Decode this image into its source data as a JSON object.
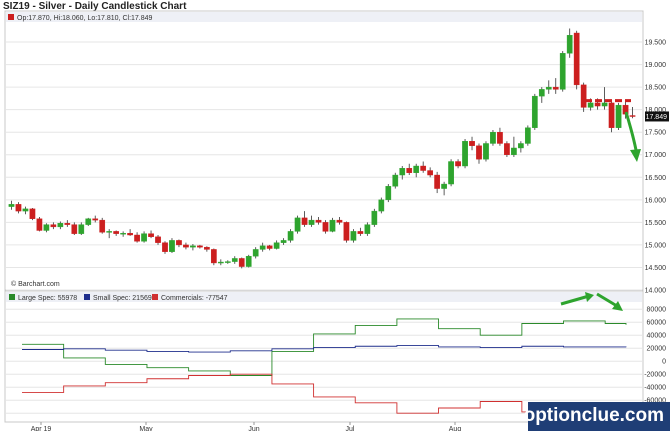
{
  "header": {
    "title": "SIZ19 - Silver - Daily Candlestick Chart",
    "ohlc_label": "Op:17.870, Hi:18.060, Lo:17.810, Cl:17.849",
    "last_price": "17.849",
    "credit": "© Barchart.com"
  },
  "watermark": "optionclue.com",
  "colors": {
    "up": "#2ea42e",
    "down": "#cc1f1f",
    "large_spec": "#2a8a2a",
    "small_spec": "#1f2e8c",
    "commercials": "#d03030",
    "annot_line": "#cc1f1f",
    "annot_arrow": "#2ea42e"
  },
  "chart_data": [
    {
      "type": "candlestick",
      "title": "SIZ19 - Silver - Daily Candlestick Chart",
      "ylim": [
        14.0,
        19.9
      ],
      "y_ticks": [
        "19.500",
        "19.000",
        "18.500",
        "18.000",
        "17.500",
        "17.000",
        "16.500",
        "16.000",
        "15.500",
        "15.000",
        "14.500",
        "14.000"
      ],
      "x_ticks": [
        "Apr 19",
        "May",
        "Jun",
        "Jul",
        "Aug"
      ],
      "annotation": {
        "resistance_level": 18.2,
        "arrow": "down"
      },
      "candles": [
        {
          "o": 15.85,
          "h": 15.98,
          "l": 15.78,
          "c": 15.9
        },
        {
          "o": 15.9,
          "h": 15.95,
          "l": 15.7,
          "c": 15.75
        },
        {
          "o": 15.75,
          "h": 15.85,
          "l": 15.68,
          "c": 15.8
        },
        {
          "o": 15.8,
          "h": 15.82,
          "l": 15.55,
          "c": 15.58
        },
        {
          "o": 15.58,
          "h": 15.62,
          "l": 15.3,
          "c": 15.32
        },
        {
          "o": 15.32,
          "h": 15.48,
          "l": 15.28,
          "c": 15.45
        },
        {
          "o": 15.45,
          "h": 15.5,
          "l": 15.35,
          "c": 15.4
        },
        {
          "o": 15.4,
          "h": 15.52,
          "l": 15.35,
          "c": 15.48
        },
        {
          "o": 15.48,
          "h": 15.55,
          "l": 15.4,
          "c": 15.45
        },
        {
          "o": 15.45,
          "h": 15.5,
          "l": 15.22,
          "c": 15.25
        },
        {
          "o": 15.25,
          "h": 15.5,
          "l": 15.22,
          "c": 15.45
        },
        {
          "o": 15.45,
          "h": 15.6,
          "l": 15.42,
          "c": 15.58
        },
        {
          "o": 15.58,
          "h": 15.65,
          "l": 15.5,
          "c": 15.55
        },
        {
          "o": 15.55,
          "h": 15.6,
          "l": 15.25,
          "c": 15.28
        },
        {
          "o": 15.28,
          "h": 15.35,
          "l": 15.15,
          "c": 15.3
        },
        {
          "o": 15.3,
          "h": 15.32,
          "l": 15.2,
          "c": 15.25
        },
        {
          "o": 15.25,
          "h": 15.3,
          "l": 15.18,
          "c": 15.26
        },
        {
          "o": 15.26,
          "h": 15.35,
          "l": 15.2,
          "c": 15.22
        },
        {
          "o": 15.22,
          "h": 15.28,
          "l": 15.05,
          "c": 15.08
        },
        {
          "o": 15.08,
          "h": 15.3,
          "l": 15.05,
          "c": 15.25
        },
        {
          "o": 15.25,
          "h": 15.32,
          "l": 15.15,
          "c": 15.18
        },
        {
          "o": 15.18,
          "h": 15.22,
          "l": 15.0,
          "c": 15.05
        },
        {
          "o": 15.05,
          "h": 15.08,
          "l": 14.8,
          "c": 14.85
        },
        {
          "o": 14.85,
          "h": 15.15,
          "l": 14.82,
          "c": 15.1
        },
        {
          "o": 15.1,
          "h": 15.12,
          "l": 14.95,
          "c": 15.0
        },
        {
          "o": 15.0,
          "h": 15.05,
          "l": 14.9,
          "c": 14.95
        },
        {
          "o": 14.95,
          "h": 15.02,
          "l": 14.88,
          "c": 14.98
        },
        {
          "o": 14.98,
          "h": 15.0,
          "l": 14.92,
          "c": 14.95
        },
        {
          "o": 14.95,
          "h": 14.97,
          "l": 14.85,
          "c": 14.9
        },
        {
          "o": 14.9,
          "h": 14.92,
          "l": 14.55,
          "c": 14.6
        },
        {
          "o": 14.6,
          "h": 14.68,
          "l": 14.55,
          "c": 14.62
        },
        {
          "o": 14.62,
          "h": 14.66,
          "l": 14.58,
          "c": 14.63
        },
        {
          "o": 14.63,
          "h": 14.75,
          "l": 14.58,
          "c": 14.7
        },
        {
          "o": 14.7,
          "h": 14.72,
          "l": 14.48,
          "c": 14.52
        },
        {
          "o": 14.52,
          "h": 14.78,
          "l": 14.5,
          "c": 14.75
        },
        {
          "o": 14.75,
          "h": 14.95,
          "l": 14.7,
          "c": 14.9
        },
        {
          "o": 14.9,
          "h": 15.05,
          "l": 14.85,
          "c": 14.98
        },
        {
          "o": 14.98,
          "h": 15.0,
          "l": 14.88,
          "c": 14.92
        },
        {
          "o": 14.92,
          "h": 15.1,
          "l": 14.9,
          "c": 15.05
        },
        {
          "o": 15.05,
          "h": 15.15,
          "l": 15.0,
          "c": 15.1
        },
        {
          "o": 15.1,
          "h": 15.35,
          "l": 15.05,
          "c": 15.3
        },
        {
          "o": 15.3,
          "h": 15.65,
          "l": 15.25,
          "c": 15.6
        },
        {
          "o": 15.6,
          "h": 15.75,
          "l": 15.4,
          "c": 15.45
        },
        {
          "o": 15.45,
          "h": 15.65,
          "l": 15.4,
          "c": 15.55
        },
        {
          "o": 15.55,
          "h": 15.62,
          "l": 15.45,
          "c": 15.5
        },
        {
          "o": 15.5,
          "h": 15.55,
          "l": 15.25,
          "c": 15.3
        },
        {
          "o": 15.3,
          "h": 15.6,
          "l": 15.28,
          "c": 15.55
        },
        {
          "o": 15.55,
          "h": 15.62,
          "l": 15.45,
          "c": 15.5
        },
        {
          "o": 15.5,
          "h": 15.52,
          "l": 15.05,
          "c": 15.1
        },
        {
          "o": 15.1,
          "h": 15.35,
          "l": 15.05,
          "c": 15.3
        },
        {
          "o": 15.3,
          "h": 15.38,
          "l": 15.2,
          "c": 15.25
        },
        {
          "o": 15.25,
          "h": 15.5,
          "l": 15.2,
          "c": 15.45
        },
        {
          "o": 15.45,
          "h": 15.8,
          "l": 15.4,
          "c": 15.75
        },
        {
          "o": 15.75,
          "h": 16.05,
          "l": 15.7,
          "c": 16.0
        },
        {
          "o": 16.0,
          "h": 16.35,
          "l": 15.95,
          "c": 16.3
        },
        {
          "o": 16.3,
          "h": 16.6,
          "l": 16.25,
          "c": 16.55
        },
        {
          "o": 16.55,
          "h": 16.75,
          "l": 16.45,
          "c": 16.7
        },
        {
          "o": 16.7,
          "h": 16.8,
          "l": 16.55,
          "c": 16.6
        },
        {
          "o": 16.6,
          "h": 16.8,
          "l": 16.5,
          "c": 16.75
        },
        {
          "o": 16.75,
          "h": 16.85,
          "l": 16.6,
          "c": 16.65
        },
        {
          "o": 16.65,
          "h": 16.72,
          "l": 16.5,
          "c": 16.55
        },
        {
          "o": 16.55,
          "h": 16.62,
          "l": 16.15,
          "c": 16.25
        },
        {
          "o": 16.25,
          "h": 16.4,
          "l": 16.1,
          "c": 16.35
        },
        {
          "o": 16.35,
          "h": 16.9,
          "l": 16.3,
          "c": 16.85
        },
        {
          "o": 16.85,
          "h": 16.9,
          "l": 16.7,
          "c": 16.75
        },
        {
          "o": 16.75,
          "h": 17.35,
          "l": 16.7,
          "c": 17.3
        },
        {
          "o": 17.3,
          "h": 17.4,
          "l": 17.1,
          "c": 17.2
        },
        {
          "o": 17.2,
          "h": 17.25,
          "l": 16.8,
          "c": 16.9
        },
        {
          "o": 16.9,
          "h": 17.3,
          "l": 16.85,
          "c": 17.25
        },
        {
          "o": 17.25,
          "h": 17.55,
          "l": 17.2,
          "c": 17.5
        },
        {
          "o": 17.5,
          "h": 17.6,
          "l": 17.2,
          "c": 17.25
        },
        {
          "o": 17.25,
          "h": 17.3,
          "l": 16.95,
          "c": 17.0
        },
        {
          "o": 17.0,
          "h": 17.4,
          "l": 16.95,
          "c": 17.15
        },
        {
          "o": 17.15,
          "h": 17.3,
          "l": 17.05,
          "c": 17.25
        },
        {
          "o": 17.25,
          "h": 17.65,
          "l": 17.2,
          "c": 17.6
        },
        {
          "o": 17.6,
          "h": 18.35,
          "l": 17.55,
          "c": 18.3
        },
        {
          "o": 18.3,
          "h": 18.5,
          "l": 18.15,
          "c": 18.45
        },
        {
          "o": 18.45,
          "h": 18.65,
          "l": 18.35,
          "c": 18.5
        },
        {
          "o": 18.5,
          "h": 18.7,
          "l": 18.35,
          "c": 18.45
        },
        {
          "o": 18.45,
          "h": 19.3,
          "l": 18.4,
          "c": 19.25
        },
        {
          "o": 19.25,
          "h": 19.8,
          "l": 19.15,
          "c": 19.65
        },
        {
          "o": 19.7,
          "h": 19.75,
          "l": 18.45,
          "c": 18.55
        },
        {
          "o": 18.55,
          "h": 18.6,
          "l": 17.95,
          "c": 18.05
        },
        {
          "o": 18.05,
          "h": 18.25,
          "l": 17.98,
          "c": 18.15
        },
        {
          "o": 18.15,
          "h": 18.25,
          "l": 18.0,
          "c": 18.08
        },
        {
          "o": 18.08,
          "h": 18.5,
          "l": 18.0,
          "c": 18.15
        },
        {
          "o": 18.15,
          "h": 18.2,
          "l": 17.5,
          "c": 17.6
        },
        {
          "o": 17.6,
          "h": 18.15,
          "l": 17.55,
          "c": 18.1
        },
        {
          "o": 18.1,
          "h": 18.2,
          "l": 17.8,
          "c": 17.9
        },
        {
          "o": 17.87,
          "h": 18.06,
          "l": 17.81,
          "c": 17.85
        }
      ]
    },
    {
      "type": "line",
      "title": "",
      "ylim": [
        -92000,
        88000
      ],
      "y_ticks": [
        "80000",
        "60000",
        "40000",
        "20000",
        "0",
        "-20000",
        "-40000",
        "-60000",
        "-80000"
      ],
      "step": true,
      "series": [
        {
          "name": "Large Spec: 55978",
          "values": [
            26000,
            26000,
            5000,
            5000,
            -5000,
            -5000,
            -10000,
            -10000,
            -15000,
            -15000,
            -22000,
            -22000,
            15000,
            15000,
            42000,
            42000,
            55000,
            55000,
            65000,
            65000,
            50000,
            50000,
            40000,
            40000,
            58000,
            58000,
            62000,
            62000,
            58000,
            56000
          ]
        },
        {
          "name": "Small Spec: 21569",
          "values": [
            18000,
            18000,
            19000,
            19000,
            17000,
            17000,
            15000,
            15000,
            14000,
            14000,
            16000,
            16000,
            19000,
            19000,
            21000,
            21000,
            23000,
            23000,
            24000,
            24000,
            22000,
            22000,
            21000,
            21000,
            23000,
            23000,
            22000,
            22000,
            22000,
            21500
          ]
        },
        {
          "name": "Commercials: -77547",
          "values": [
            -48000,
            -48000,
            -38000,
            -38000,
            -33000,
            -33000,
            -27000,
            -27000,
            -22000,
            -22000,
            -20000,
            -20000,
            -35000,
            -35000,
            -55000,
            -55000,
            -64000,
            -64000,
            -80000,
            -80000,
            -72000,
            -72000,
            -62000,
            -62000,
            -78000,
            -78000,
            -85000,
            -85000,
            -80000,
            -77500
          ]
        }
      ]
    }
  ]
}
